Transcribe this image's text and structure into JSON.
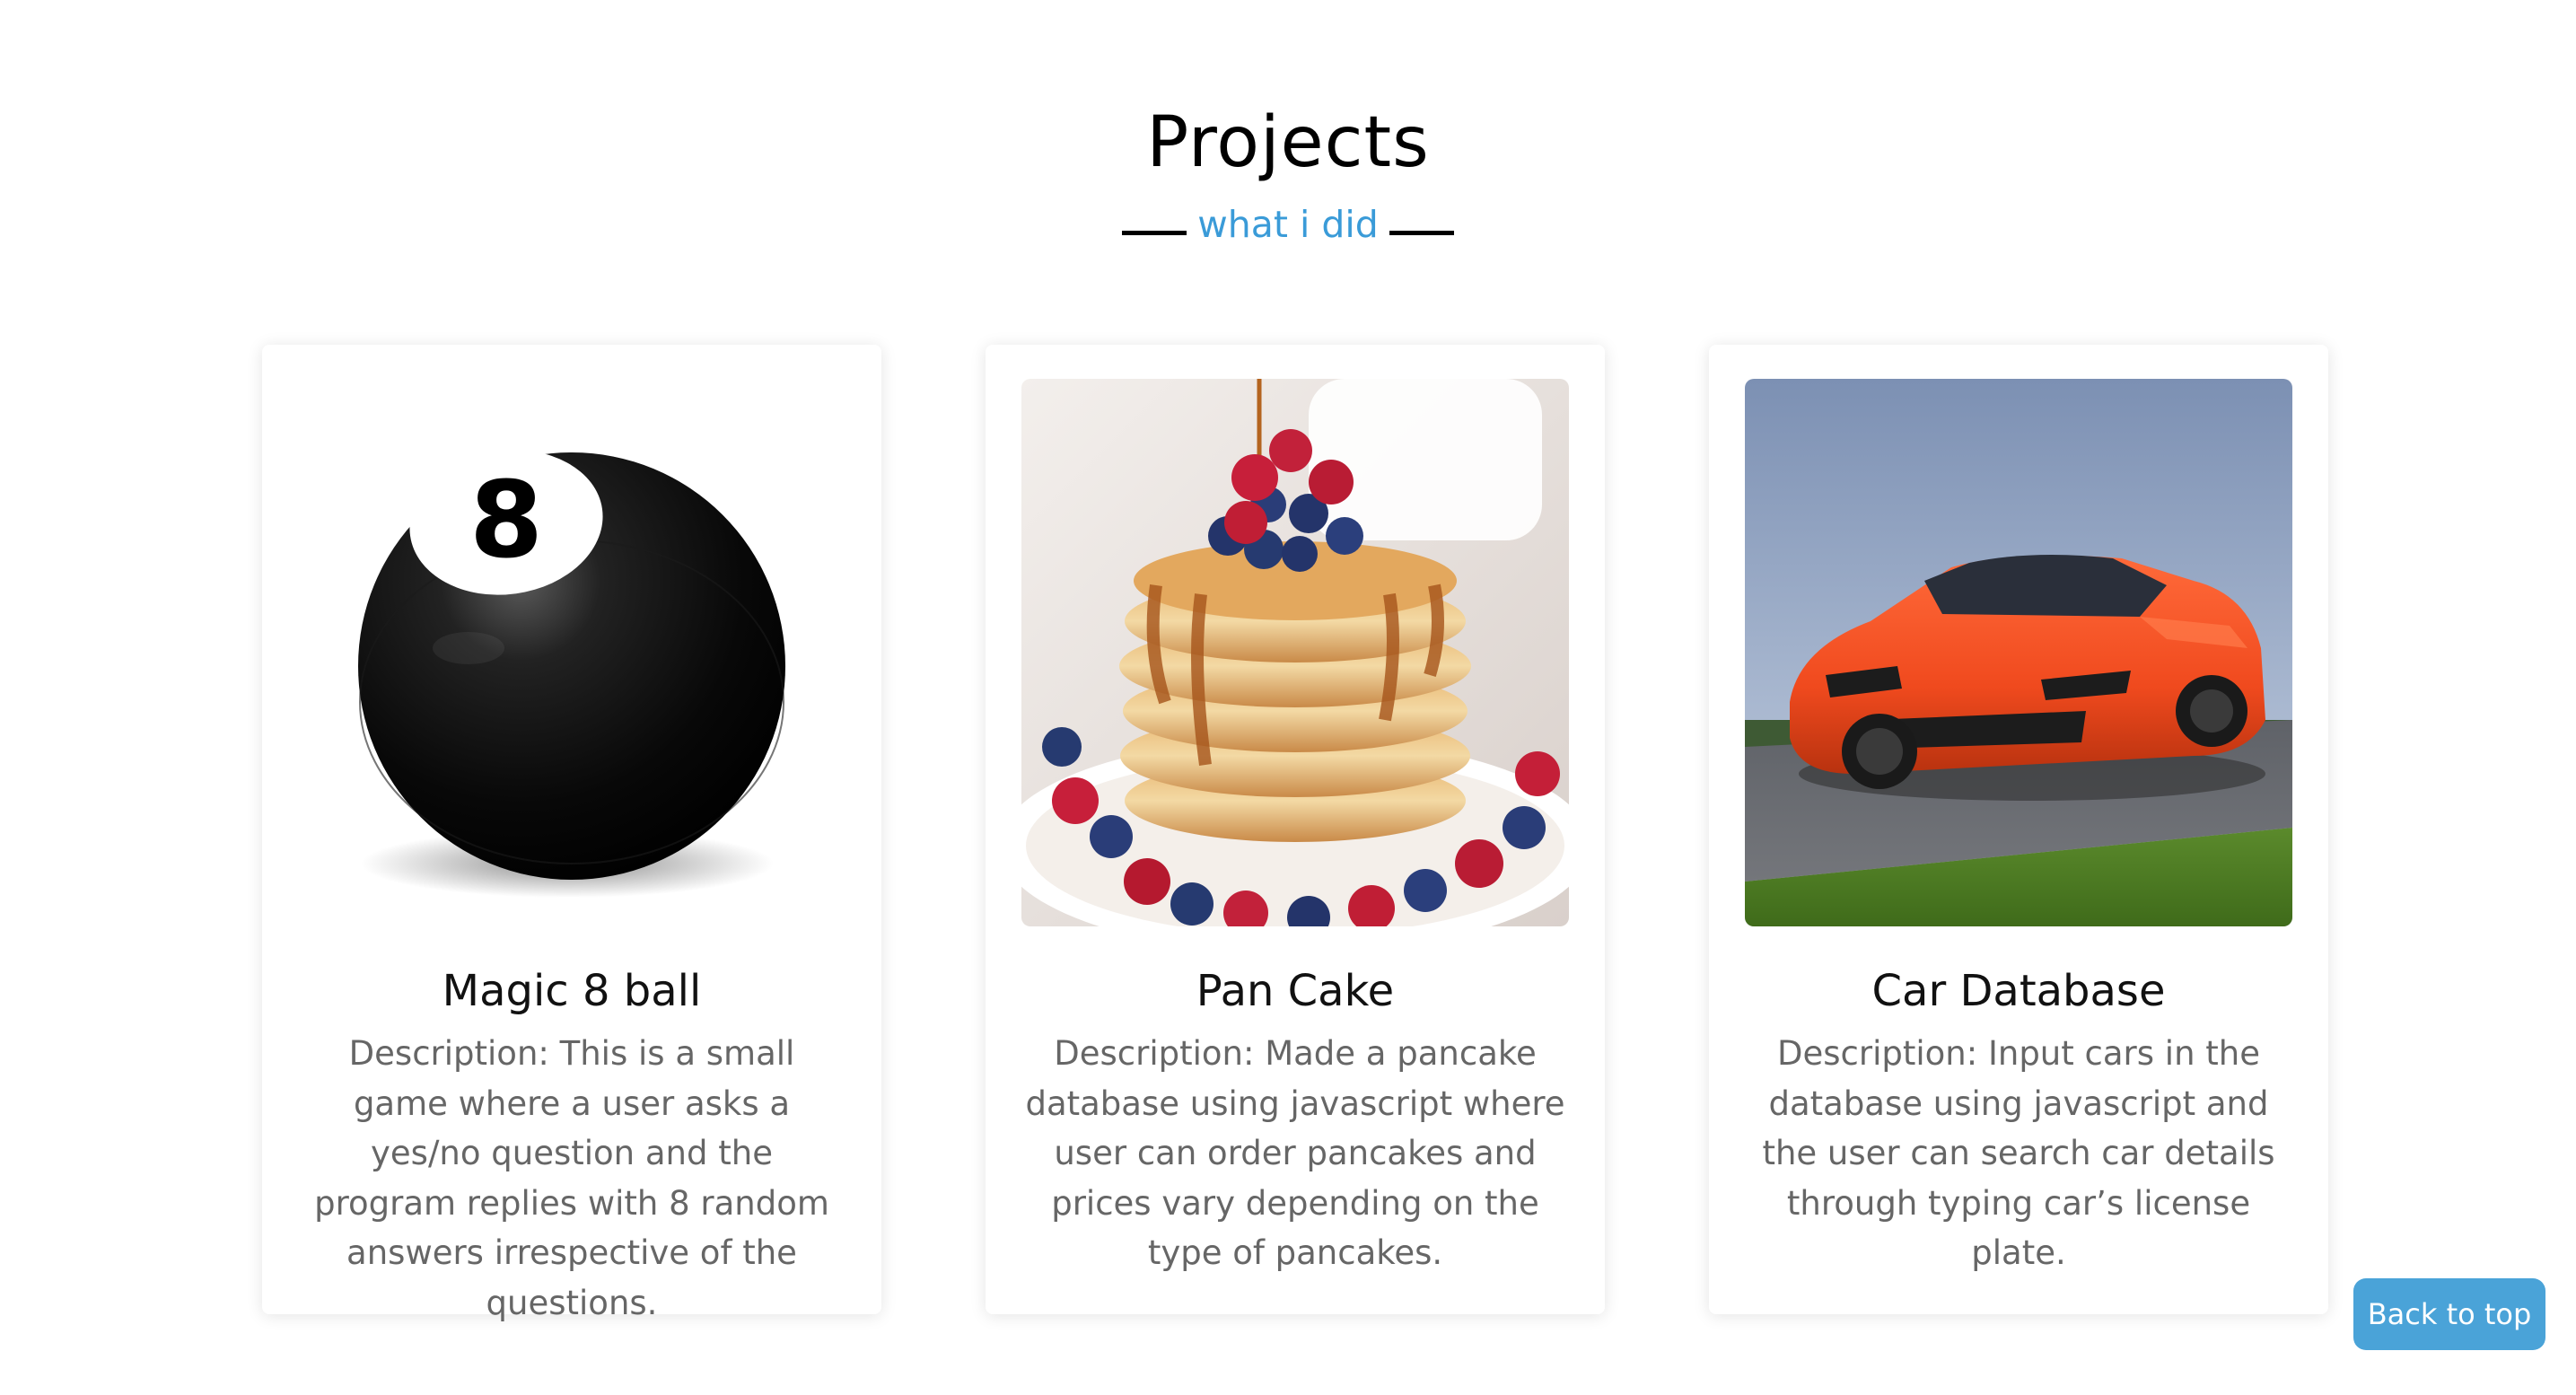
{
  "section": {
    "title": "Projects",
    "subtitle": "what i did"
  },
  "projects": [
    {
      "title": "Magic 8 ball",
      "description": "Description: This is a small game where a user asks a yes/no question and the program replies with 8 random answers irrespective of the questions.",
      "image": "magic-8-ball-photo"
    },
    {
      "title": "Pan Cake",
      "description": "Description: Made a pancake database using javascript where user can order pancakes and prices vary depending on the type of pancakes.",
      "image": "pancake-stack-photo"
    },
    {
      "title": "Car Database",
      "description": "Description: Input cars in the database using javascript and the user can search car details through typing car’s license plate.",
      "image": "orange-sports-car-photo"
    }
  ],
  "back_to_top": {
    "label": "Back to top"
  },
  "colors": {
    "accent": "#3a9bd8",
    "button": "#4aa3d8",
    "description_text": "#666666"
  }
}
